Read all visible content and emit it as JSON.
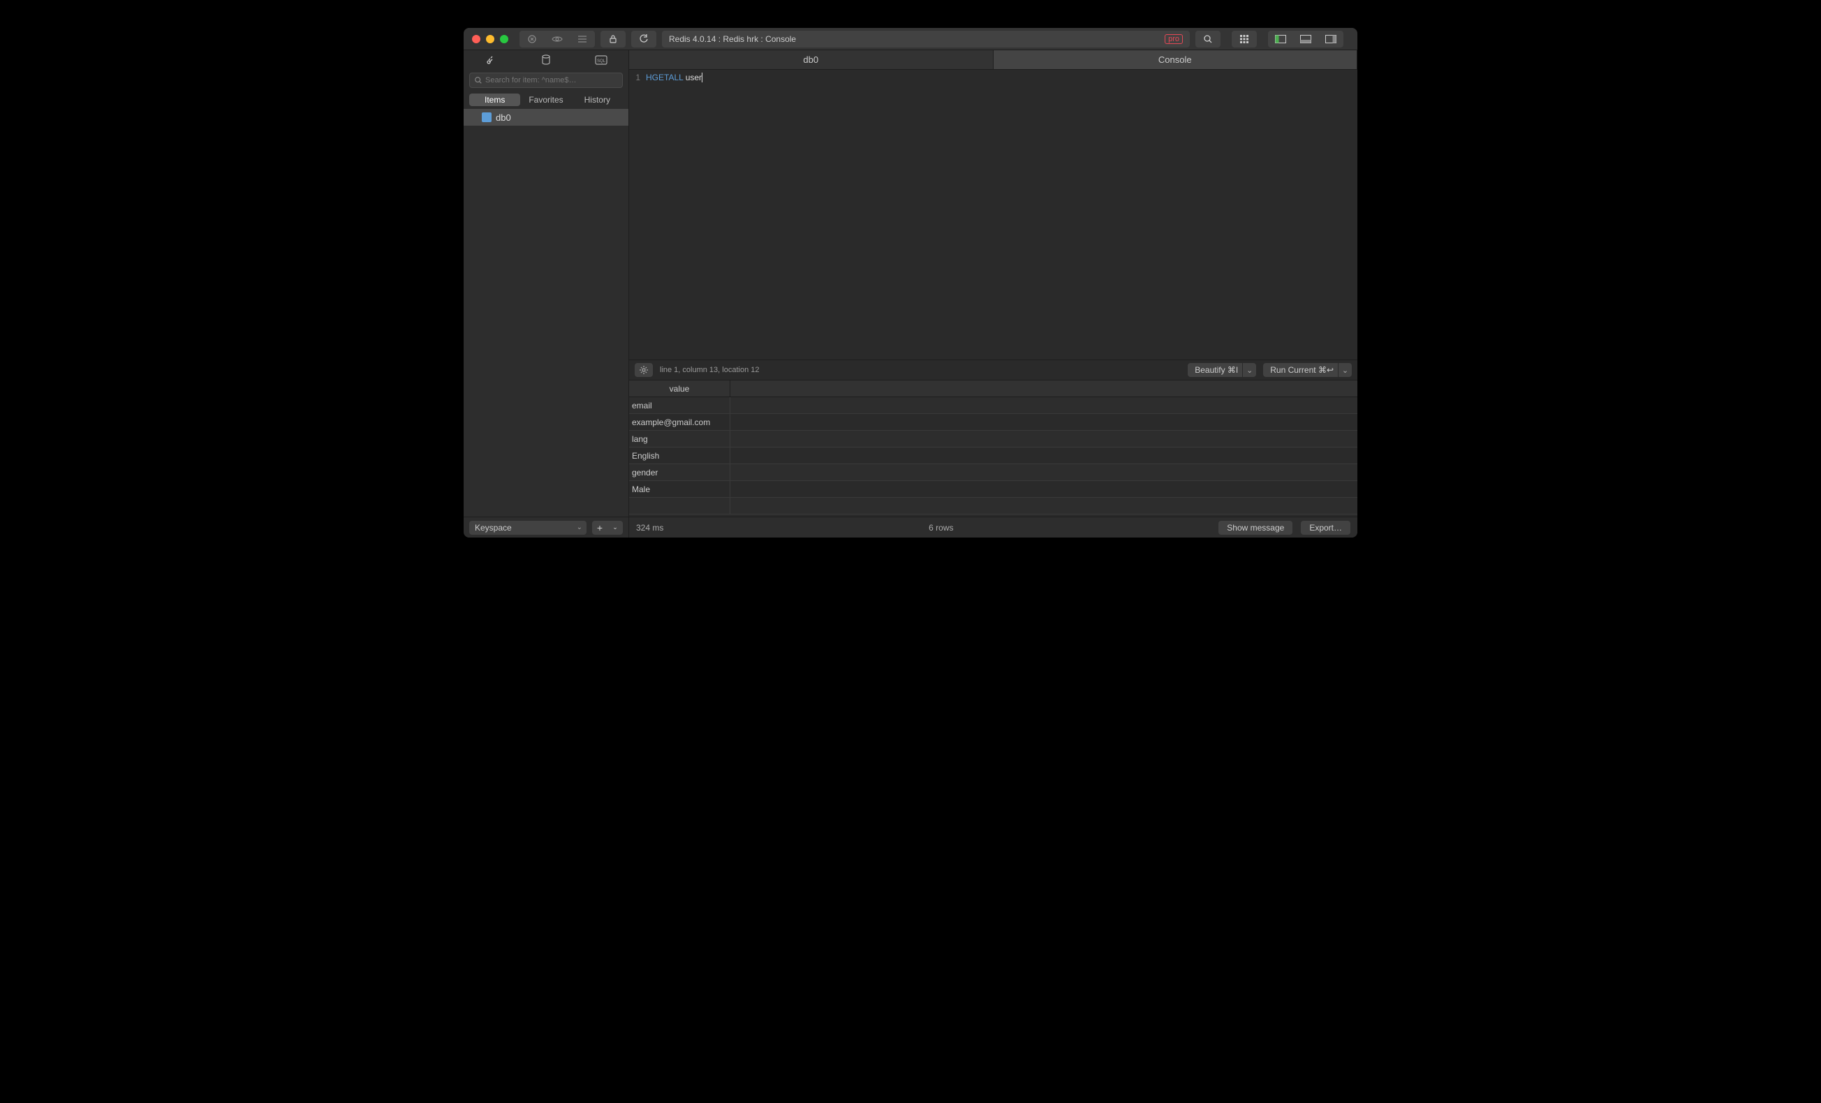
{
  "titlebar": {
    "title": "Redis 4.0.14 : Redis hrk : Console",
    "pro": "pro"
  },
  "sidebar": {
    "search_placeholder": "Search for item: ^name$…",
    "tabs": [
      "Items",
      "Favorites",
      "History"
    ],
    "items": [
      {
        "label": "db0"
      }
    ],
    "footer_select": "Keyspace"
  },
  "content_tabs": [
    "db0",
    "Console"
  ],
  "editor": {
    "line_num": "1",
    "keyword": "HGETALL",
    "arg": "user"
  },
  "editor_bar": {
    "location": "line 1, column 13, location 12",
    "beautify": "Beautify ⌘I",
    "run": "Run Current ⌘↩"
  },
  "results": {
    "header": "value",
    "rows": [
      "email",
      "example@gmail.com",
      "lang",
      "English",
      "gender",
      "Male"
    ]
  },
  "statusbar": {
    "elapsed": "324 ms",
    "rows": "6 rows",
    "show_message": "Show message",
    "export": "Export…"
  }
}
